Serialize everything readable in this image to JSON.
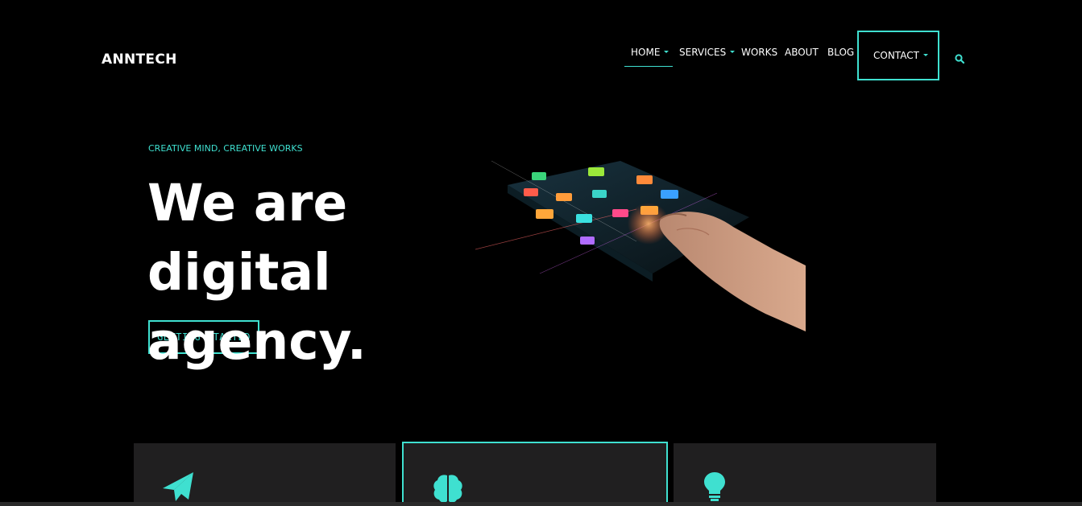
{
  "brand": {
    "name": "ANNTECH"
  },
  "nav": {
    "items": [
      {
        "label": "HOME",
        "dropdown": true,
        "active": true
      },
      {
        "label": "SERVICES",
        "dropdown": true
      },
      {
        "label": "WORKS"
      },
      {
        "label": "ABOUT"
      },
      {
        "label": "BLOG"
      },
      {
        "label": "CONTACT",
        "dropdown": true,
        "boxed": true
      }
    ],
    "search_icon": "search-icon"
  },
  "hero": {
    "tagline": "CREATIVE MIND, CREATIVE WORKS",
    "title_line1": "We are digital",
    "title_line2": "agency.",
    "cta_label": "GETTING STARTED",
    "image": "hand-touching-digital-app-interface"
  },
  "features": {
    "cards": [
      {
        "icon": "paper-plane-icon",
        "highlighted": false
      },
      {
        "icon": "brain-icon",
        "highlighted": true
      },
      {
        "icon": "lightbulb-icon",
        "highlighted": false
      }
    ]
  },
  "colors": {
    "background": "#000000",
    "accent": "#3fe0d0",
    "text": "#ffffff",
    "card_background": "#201f20"
  }
}
